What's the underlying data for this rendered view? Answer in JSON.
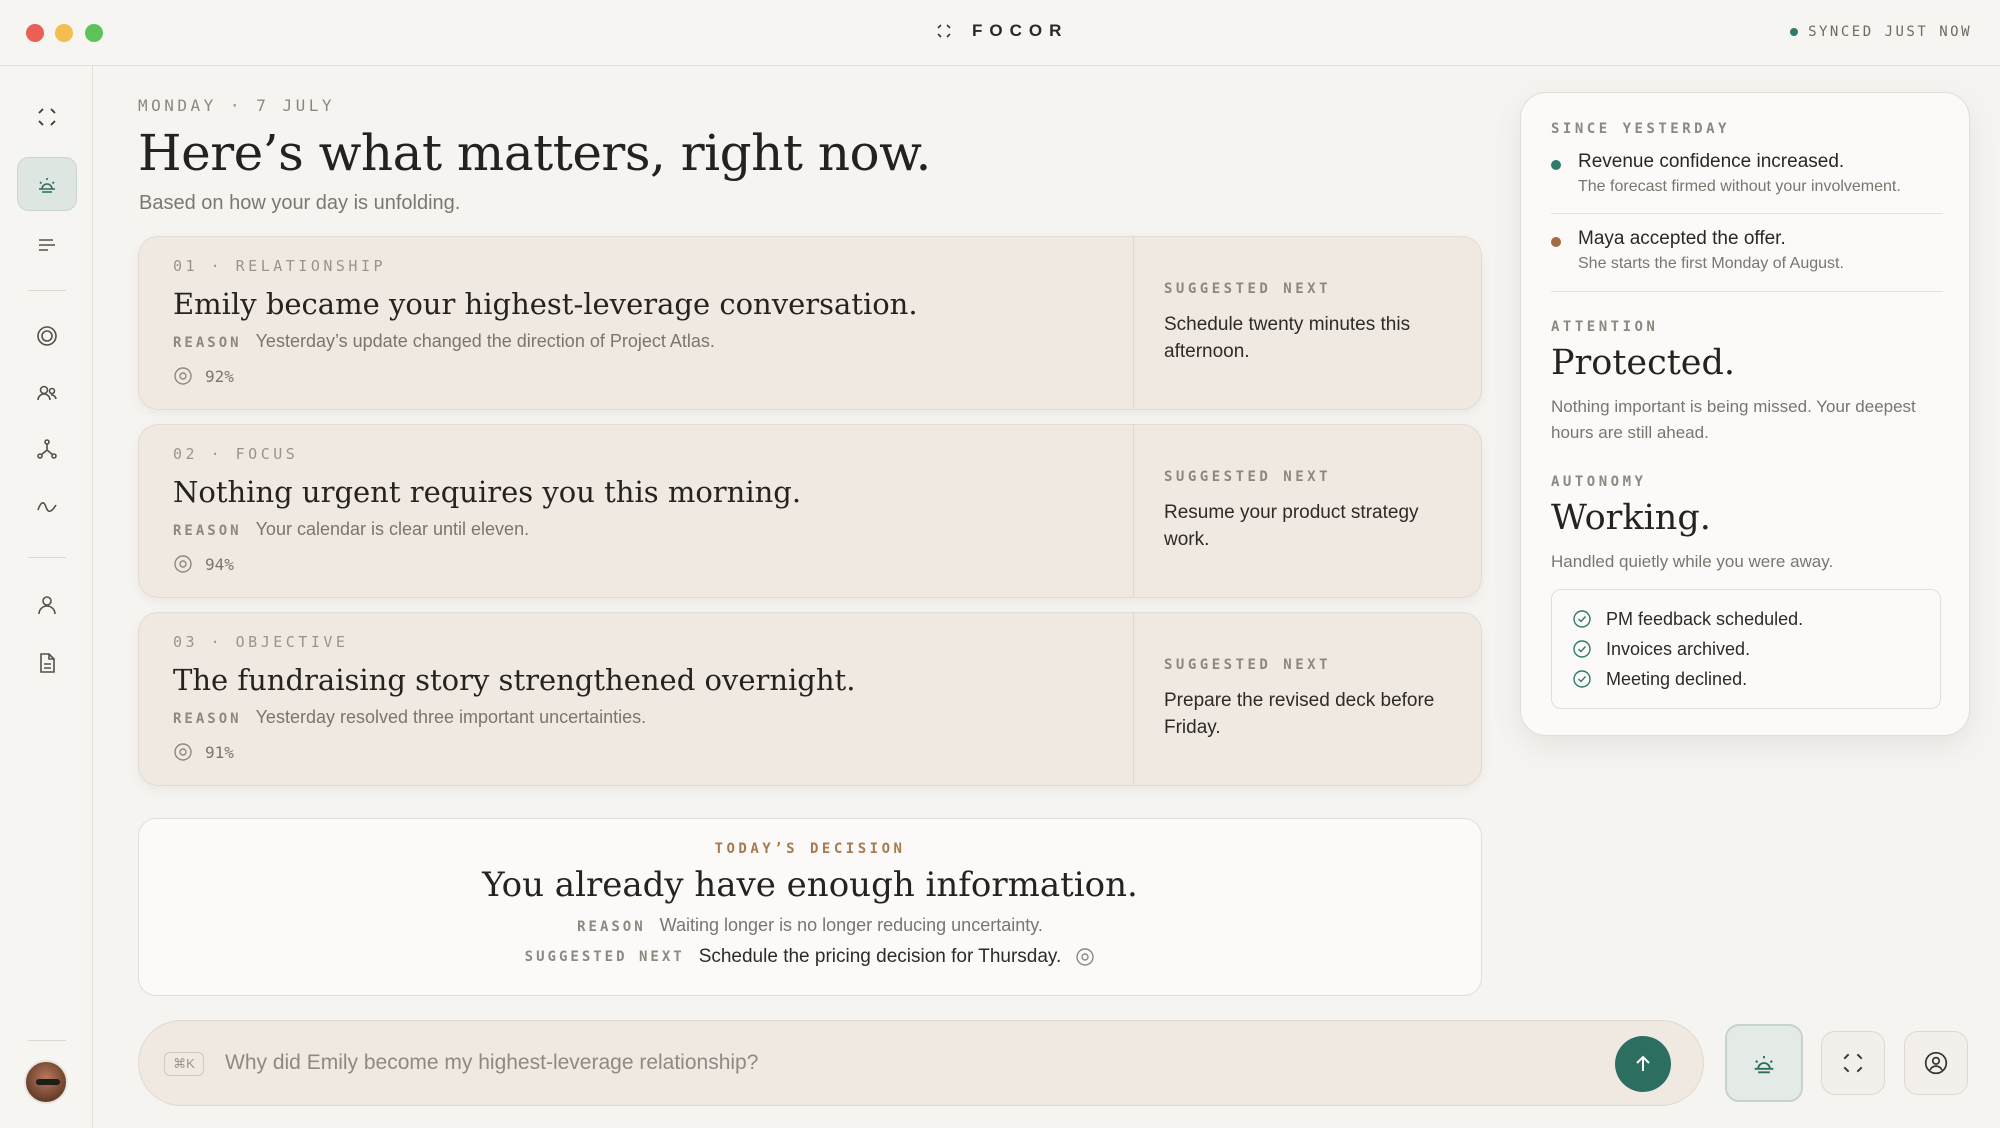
{
  "app": {
    "brand": "FOCOR",
    "sync_status": "SYNCED JUST NOW"
  },
  "header": {
    "date": "MONDAY · 7 JULY",
    "title": "Here’s what matters, right now.",
    "subtitle": "Based on how your day is unfolding."
  },
  "cards": [
    {
      "meta": "01 · RELATIONSHIP",
      "title": "Emily became your highest-leverage conversation.",
      "reason_label": "REASON",
      "reason": "Yesterday’s update changed the direction of Project Atlas.",
      "confidence": "92%",
      "next_label": "SUGGESTED NEXT",
      "next": "Schedule twenty minutes this afternoon."
    },
    {
      "meta": "02 · FOCUS",
      "title": "Nothing urgent requires you this morning.",
      "reason_label": "REASON",
      "reason": "Your calendar is clear until eleven.",
      "confidence": "94%",
      "next_label": "SUGGESTED NEXT",
      "next": "Resume your product strategy work."
    },
    {
      "meta": "03 · OBJECTIVE",
      "title": "The fundraising story strengthened overnight.",
      "reason_label": "REASON",
      "reason": "Yesterday resolved three important uncertainties.",
      "confidence": "91%",
      "next_label": "SUGGESTED NEXT",
      "next": "Prepare the revised deck before Friday."
    }
  ],
  "decision": {
    "label": "TODAY’S DECISION",
    "title": "You already have enough information.",
    "reason_label": "REASON",
    "reason": "Waiting longer is no longer reducing uncertainty.",
    "next_label": "SUGGESTED NEXT",
    "next": "Schedule the pricing decision for Thursday."
  },
  "input": {
    "shortcut": "⌘K",
    "placeholder": "Why did Emily become my highest-leverage relationship?"
  },
  "panel": {
    "since_label": "SINCE YESTERDAY",
    "updates": [
      {
        "title": "Revenue confidence increased.",
        "detail": "The forecast firmed without your involvement.",
        "color": "#2f7a6b"
      },
      {
        "title": "Maya accepted the offer.",
        "detail": "She starts the first Monday of August.",
        "color": "#a36a43"
      }
    ],
    "attention_label": "ATTENTION",
    "attention_state": "Protected.",
    "attention_text": "Nothing important is being missed. Your deepest hours are still ahead.",
    "autonomy_label": "AUTONOMY",
    "autonomy_state": "Working.",
    "autonomy_text": "Handled quietly while you were away.",
    "handled": [
      "PM feedback scheduled.",
      "Invoices archived.",
      "Meeting declined."
    ]
  },
  "colors": {
    "accent": "#2c6f61",
    "decision_label": "#a77a4e"
  },
  "icons": {
    "brand": "focus-brackets-icon",
    "sidebar": [
      "focus-brackets-icon",
      "sunrise-icon",
      "lines-icon",
      "target-icon",
      "people-icon",
      "network-icon",
      "pulse-icon",
      "person-icon",
      "document-icon"
    ],
    "send": "arrow-up-icon",
    "tools": [
      "sunrise-icon",
      "focus-brackets-icon",
      "user-circle-icon"
    ]
  }
}
